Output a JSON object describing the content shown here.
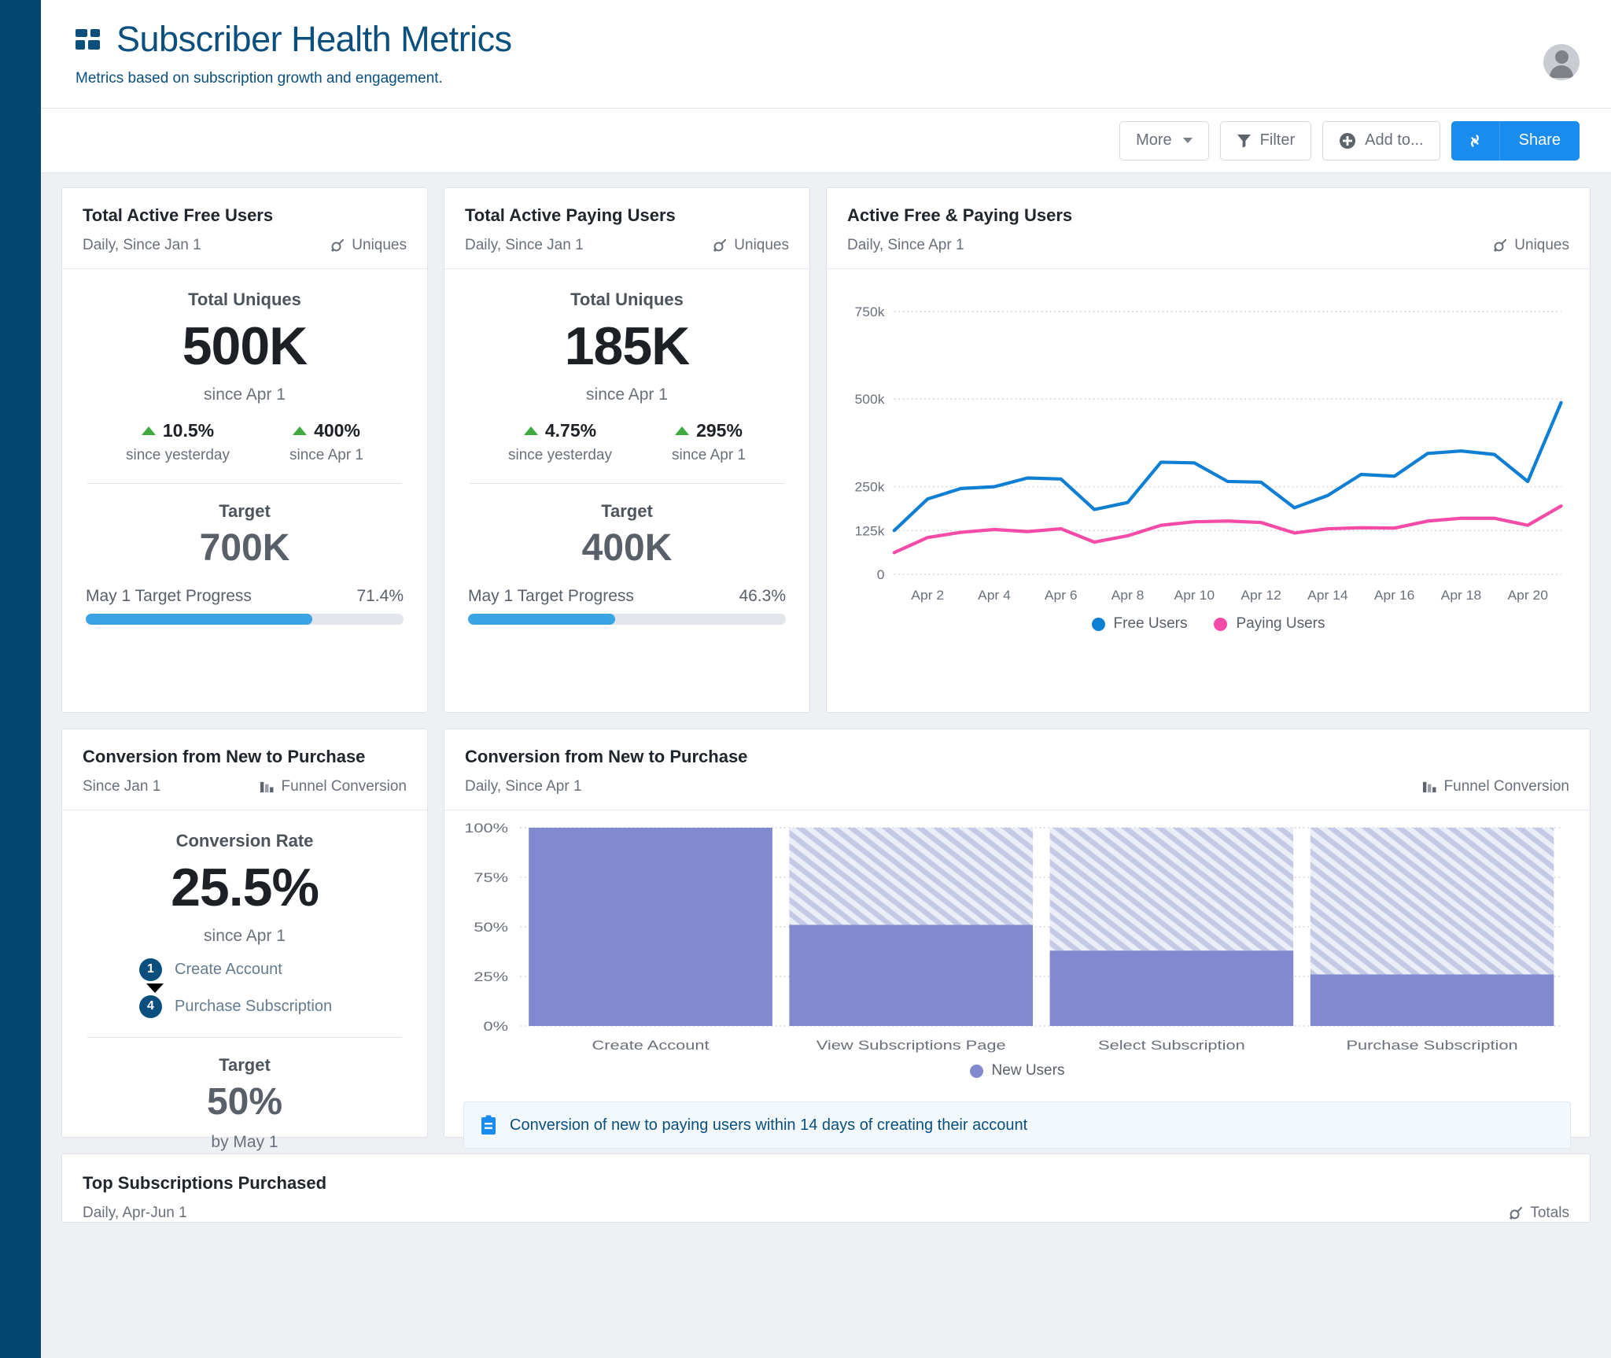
{
  "header": {
    "title": "Subscriber Health Metrics",
    "subtitle": "Metrics based on subscription growth and engagement.",
    "logo_icon": "dashboard-grid-icon",
    "avatar_icon": "user-avatar-icon"
  },
  "toolbar": {
    "more_label": "More",
    "filter_label": "Filter",
    "add_to_label": "Add to...",
    "share_label": "Share",
    "link_icon": "link-chain-icon",
    "filter_icon": "funnel-icon",
    "add_icon": "plus-circle-icon",
    "chevron_icon": "chevron-down-icon",
    "accent_color": "#1a8cf0"
  },
  "cards": {
    "free_users": {
      "title": "Total Active Free Users",
      "subtitle": "Daily, Since Jan 1",
      "tag": "Uniques",
      "tag_icon": "uniques-icon",
      "metric_label": "Total Uniques",
      "metric_value": "500K",
      "metric_since": "since Apr 1",
      "deltas": [
        {
          "value": "10.5%",
          "caption": "since yesterday",
          "direction": "up"
        },
        {
          "value": "400%",
          "caption": "since Apr 1",
          "direction": "up"
        }
      ],
      "target_label": "Target",
      "target_value": "700K",
      "progress_label": "May 1 Target Progress",
      "progress_value": "71.4%",
      "progress_pct": 71.4
    },
    "paying_users": {
      "title": "Total Active Paying Users",
      "subtitle": "Daily, Since Jan 1",
      "tag": "Uniques",
      "tag_icon": "uniques-icon",
      "metric_label": "Total Uniques",
      "metric_value": "185K",
      "metric_since": "since Apr 1",
      "deltas": [
        {
          "value": "4.75%",
          "caption": "since yesterday",
          "direction": "up"
        },
        {
          "value": "295%",
          "caption": "since Apr 1",
          "direction": "up"
        }
      ],
      "target_label": "Target",
      "target_value": "400K",
      "progress_label": "May 1 Target Progress",
      "progress_value": "46.3%",
      "progress_pct": 46.3
    },
    "active_chart": {
      "title": "Active Free & Paying Users",
      "subtitle": "Daily, Since Apr 1",
      "tag": "Uniques",
      "tag_icon": "uniques-icon"
    },
    "conversion_kpi": {
      "title": "Conversion from New to Purchase",
      "subtitle": "Since Jan 1",
      "tag": "Funnel Conversion",
      "tag_icon": "funnel-conversion-icon",
      "metric_label": "Conversion Rate",
      "metric_value": "25.5%",
      "metric_since": "since Apr 1",
      "steps": [
        {
          "badge": "1",
          "label": "Create Account"
        },
        {
          "badge": "4",
          "label": "Purchase Subscription"
        }
      ],
      "target_label": "Target",
      "target_value": "50%",
      "target_by": "by May 1"
    },
    "conversion_chart": {
      "title": "Conversion from New to Purchase",
      "subtitle": "Daily, Since Apr 1",
      "tag": "Funnel Conversion",
      "tag_icon": "funnel-conversion-icon",
      "note": "Conversion of new to paying users within 14 days of creating their account",
      "note_icon": "clipboard-icon"
    },
    "top_subscriptions": {
      "title": "Top Subscriptions Purchased",
      "subtitle": "Daily, Apr-Jun 1",
      "tag": "Totals",
      "tag_icon": "uniques-icon"
    }
  },
  "chart_data": [
    {
      "type": "line",
      "title": "Active Free & Paying Users",
      "xlabel": "",
      "ylabel": "",
      "ylim": [
        0,
        812500
      ],
      "yticks": [
        0,
        125000,
        250000,
        500000,
        750000
      ],
      "ytick_labels": [
        "0",
        "125k",
        "250k",
        "500k",
        "750k"
      ],
      "x": [
        "Apr 1",
        "Apr 2",
        "Apr 3",
        "Apr 4",
        "Apr 5",
        "Apr 6",
        "Apr 7",
        "Apr 8",
        "Apr 9",
        "Apr 10",
        "Apr 11",
        "Apr 12",
        "Apr 13",
        "Apr 14",
        "Apr 15",
        "Apr 16",
        "Apr 17",
        "Apr 18",
        "Apr 19",
        "Apr 20",
        "Apr 21"
      ],
      "xtick_labels": [
        "Apr 2",
        "Apr 4",
        "Apr 6",
        "Apr 8",
        "Apr 10",
        "Apr 12",
        "Apr 14",
        "Apr 16",
        "Apr 18",
        "Apr 20"
      ],
      "grid": true,
      "legend_position": "bottom",
      "series": [
        {
          "name": "Free Users",
          "color": "#0f7fd4",
          "values": [
            125000,
            215000,
            245000,
            250000,
            275000,
            272000,
            185000,
            205000,
            320000,
            318000,
            265000,
            263000,
            190000,
            225000,
            285000,
            280000,
            345000,
            352000,
            342000,
            265000,
            490000
          ]
        },
        {
          "name": "Paying Users",
          "color": "#f54ba8",
          "values": [
            62000,
            105000,
            120000,
            128000,
            122000,
            130000,
            92000,
            110000,
            140000,
            150000,
            152000,
            148000,
            118000,
            130000,
            133000,
            132000,
            152000,
            160000,
            160000,
            140000,
            195000
          ]
        }
      ]
    },
    {
      "type": "bar",
      "title": "Conversion from New to Purchase",
      "categories": [
        "Create Account",
        "View Subscriptions Page",
        "Select Subscription",
        "Purchase Subscription"
      ],
      "values": [
        100,
        51,
        38,
        26
      ],
      "series": [
        {
          "name": "New Users",
          "color": "#8189cf",
          "values": [
            100,
            51,
            38,
            26
          ]
        }
      ],
      "ylabel": "",
      "xlabel": "",
      "ylim": [
        0,
        100
      ],
      "yticks": [
        0,
        25,
        50,
        75,
        100
      ],
      "ytick_labels": [
        "0%",
        "25%",
        "50%",
        "75%",
        "100%"
      ],
      "grid": true,
      "legend_position": "bottom",
      "legend_entries": [
        "New Users"
      ],
      "remainder_style": "hatched"
    }
  ]
}
